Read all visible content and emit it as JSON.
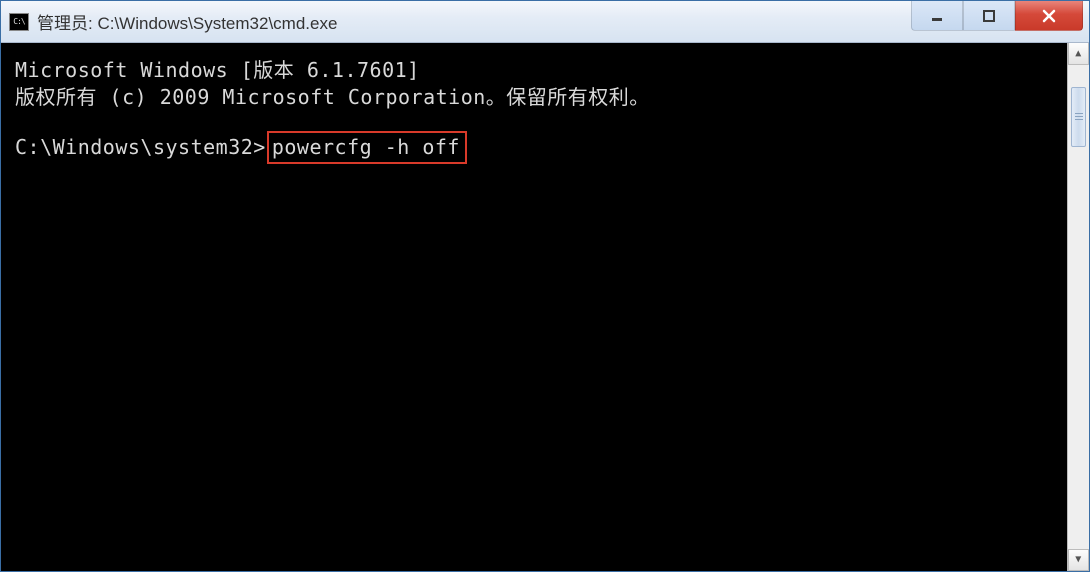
{
  "window": {
    "icon_label": "C:\\",
    "title": "管理员: C:\\Windows\\System32\\cmd.exe"
  },
  "controls": {
    "minimize": "—",
    "maximize": "☐",
    "close": "✕"
  },
  "terminal": {
    "line1": "Microsoft Windows [版本 6.1.7601]",
    "line2": "版权所有 (c) 2009 Microsoft Corporation。保留所有权利。",
    "prompt": "C:\\Windows\\system32>",
    "command": "powercfg -h off"
  },
  "scrollbar": {
    "up_glyph": "▲",
    "down_glyph": "▼"
  }
}
